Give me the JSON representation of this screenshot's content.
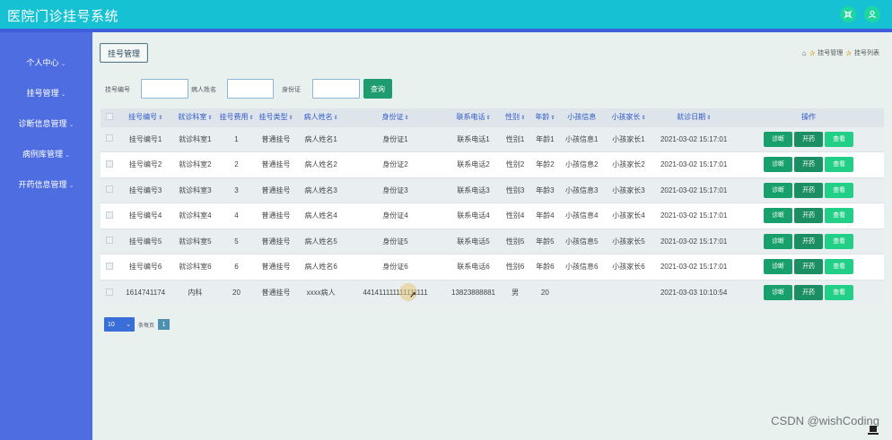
{
  "app": {
    "title": "医院门诊挂号系统"
  },
  "topbar": {
    "icon_fullscreen": "shrink-icon",
    "icon_user": "user-icon",
    "accent": "#16c1d3"
  },
  "sidebar": {
    "items": [
      {
        "label": "个人中心"
      },
      {
        "label": "挂号管理"
      },
      {
        "label": "诊断信息管理"
      },
      {
        "label": "病例库管理"
      },
      {
        "label": "开药信息管理"
      }
    ]
  },
  "page": {
    "tab_label": "挂号管理",
    "breadcrumb": [
      "挂号管理",
      "挂号列表"
    ]
  },
  "search": {
    "field1_label": "挂号编号",
    "field1_value": "",
    "field2_label": "病人姓名",
    "field2_value": "",
    "field3_label": "身份证",
    "field3_value": "",
    "query_label": "查询"
  },
  "table": {
    "headers": [
      "挂号编号",
      "就诊科室",
      "挂号费用",
      "挂号类型",
      "病人姓名",
      "身份证",
      "联系电话",
      "性别",
      "年龄",
      "小孩信息",
      "小孩家长",
      "就诊日期",
      "操作"
    ],
    "sortable": [
      true,
      true,
      true,
      true,
      true,
      true,
      true,
      true,
      true,
      false,
      true,
      true,
      false
    ],
    "actions": {
      "diagnose": "诊断",
      "prescribe": "开药",
      "view": "查看"
    },
    "rows": [
      [
        "挂号编号1",
        "就诊科室1",
        "1",
        "普通挂号",
        "病人姓名1",
        "身份证1",
        "联系电话1",
        "性别1",
        "年龄1",
        "小孩信息1",
        "小孩家长1",
        "2021-03-02 15:17:01"
      ],
      [
        "挂号编号2",
        "就诊科室2",
        "2",
        "普通挂号",
        "病人姓名2",
        "身份证2",
        "联系电话2",
        "性别2",
        "年龄2",
        "小孩信息2",
        "小孩家长2",
        "2021-03-02 15:17:01"
      ],
      [
        "挂号编号3",
        "就诊科室3",
        "3",
        "普通挂号",
        "病人姓名3",
        "身份证3",
        "联系电话3",
        "性别3",
        "年龄3",
        "小孩信息3",
        "小孩家长3",
        "2021-03-02 15:17:01"
      ],
      [
        "挂号编号4",
        "就诊科室4",
        "4",
        "普通挂号",
        "病人姓名4",
        "身份证4",
        "联系电话4",
        "性别4",
        "年龄4",
        "小孩信息4",
        "小孩家长4",
        "2021-03-02 15:17:01"
      ],
      [
        "挂号编号5",
        "就诊科室5",
        "5",
        "普通挂号",
        "病人姓名5",
        "身份证5",
        "联系电话5",
        "性别5",
        "年龄5",
        "小孩信息5",
        "小孩家长5",
        "2021-03-02 15:17:01"
      ],
      [
        "挂号编号6",
        "就诊科室6",
        "6",
        "普通挂号",
        "病人姓名6",
        "身份证6",
        "联系电话6",
        "性别6",
        "年龄6",
        "小孩信息6",
        "小孩家长6",
        "2021-03-02 15:17:01"
      ],
      [
        "1614741174",
        "内科",
        "20",
        "普通挂号",
        "xxxx病人",
        "441411111111111111",
        "13823888881",
        "男",
        "20",
        "",
        "",
        "2021-03-03 10:10:54"
      ]
    ]
  },
  "pager": {
    "page_size": "10",
    "per_page_label": "条每页",
    "current_page": "1"
  },
  "watermark": {
    "text": "CSDN @wishCoding"
  }
}
